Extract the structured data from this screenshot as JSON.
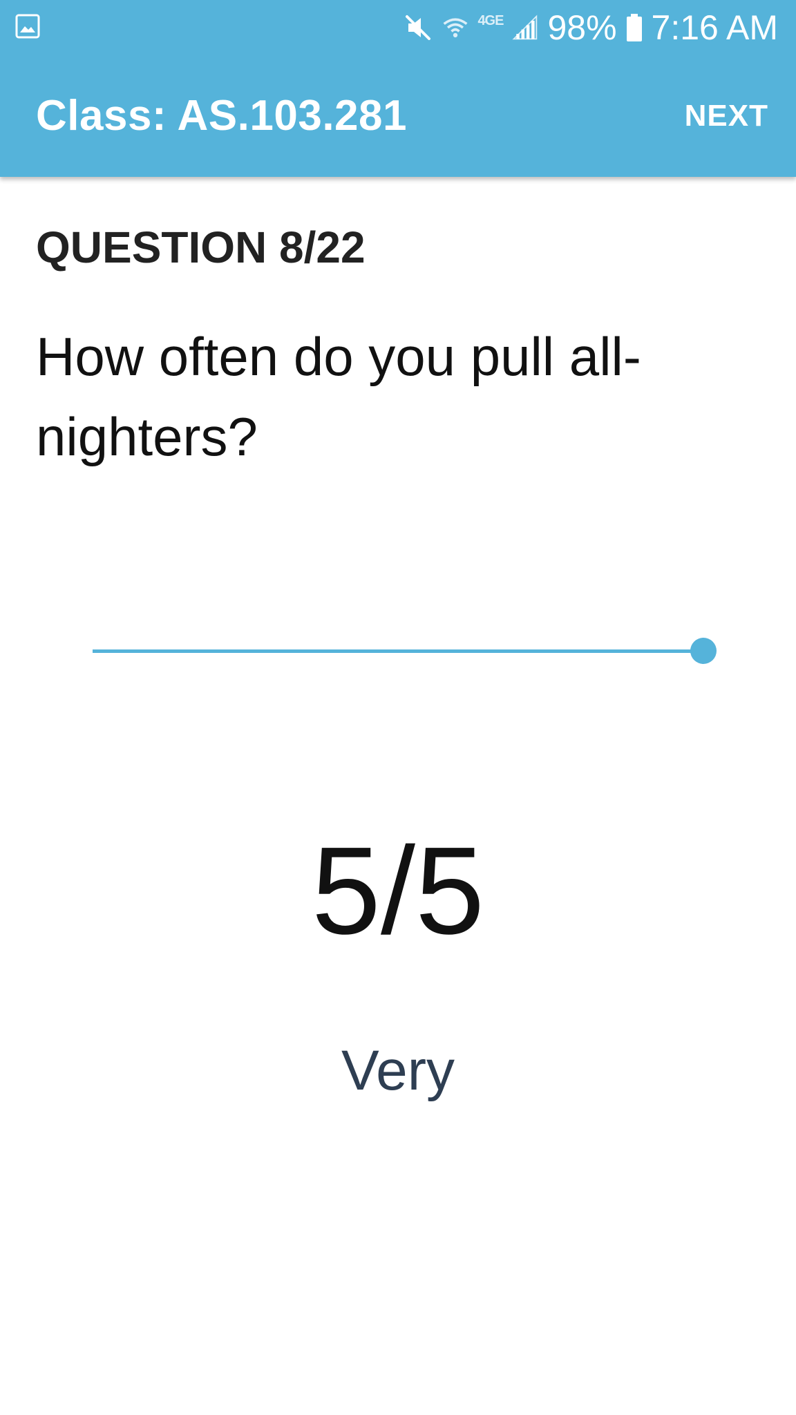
{
  "status_bar": {
    "left_icon": "image-icon",
    "icons": [
      "mute-icon",
      "wifi-icon",
      "4g-lte-icon",
      "signal-icon",
      "battery-icon"
    ],
    "network_label": "4GE",
    "battery": "98%",
    "time": "7:16 AM"
  },
  "app_bar": {
    "title": "Class: AS.103.281",
    "next_label": "NEXT",
    "color": "#55B3DA"
  },
  "question": {
    "number_label": "QUESTION 8/22",
    "text": "How often do you pull all-nighters?"
  },
  "slider": {
    "min": 1,
    "max": 5,
    "value": 5,
    "accent_color": "#55B3DA"
  },
  "answer": {
    "score": "5/5",
    "label": "Very"
  }
}
